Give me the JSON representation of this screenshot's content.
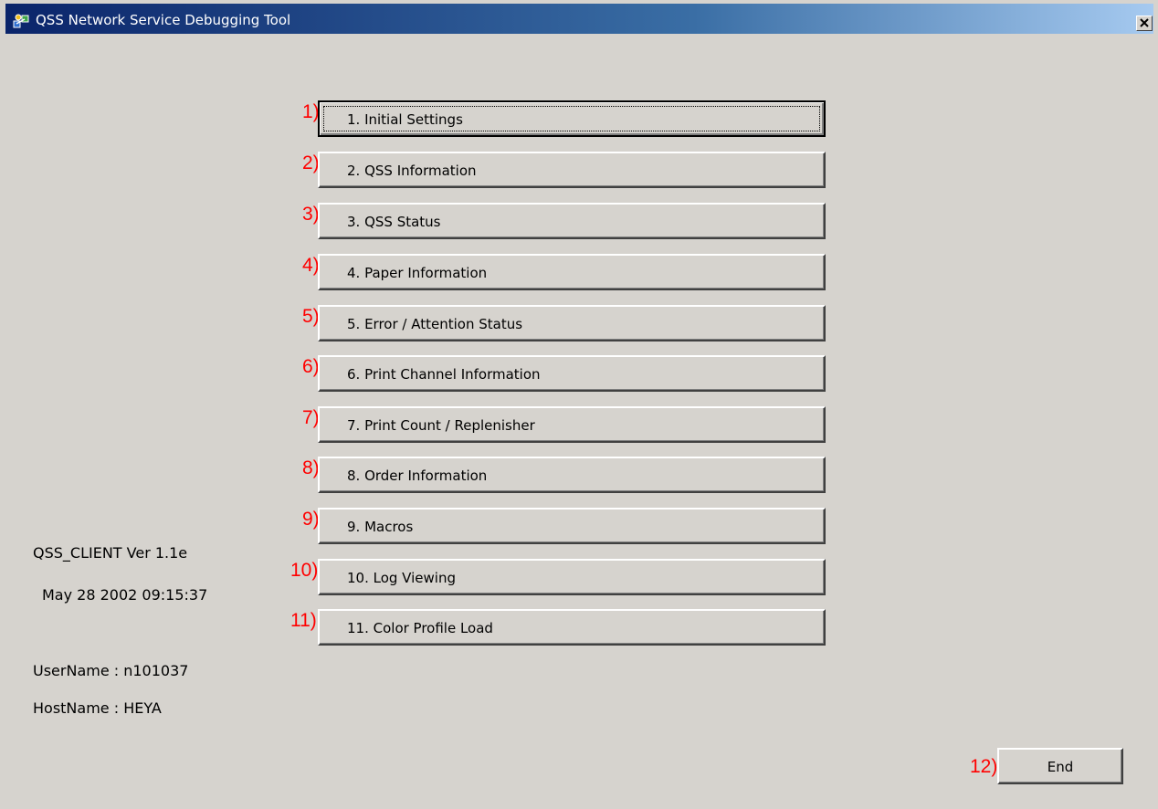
{
  "window": {
    "title": "QSS Network Service Debugging Tool",
    "close_icon": "close-icon",
    "titlebar_colors": [
      "#0a246a",
      "#a6caf0"
    ]
  },
  "menu": {
    "buttons": [
      {
        "marker": "1)",
        "label": "1.  Initial Settings"
      },
      {
        "marker": "2)",
        "label": "2.  QSS Information"
      },
      {
        "marker": "3)",
        "label": "3.  QSS Status"
      },
      {
        "marker": "4)",
        "label": "4.  Paper Information"
      },
      {
        "marker": "5)",
        "label": "5.  Error / Attention Status"
      },
      {
        "marker": "6)",
        "label": "6.  Print Channel Information"
      },
      {
        "marker": "7)",
        "label": "7.  Print Count / Replenisher"
      },
      {
        "marker": "8)",
        "label": "8.  Order Information"
      },
      {
        "marker": "9)",
        "label": "9.  Macros"
      },
      {
        "marker": "10)",
        "label": "10. Log Viewing"
      },
      {
        "marker": "11)",
        "label": "11. Color Profile Load"
      }
    ]
  },
  "info": {
    "version": "QSS_CLIENT Ver 1.1e",
    "build_date": "May 28 2002 09:15:37",
    "username": "UserName : n101037",
    "hostname": "HostName : HEYA"
  },
  "footer": {
    "end_marker": "12)",
    "end_label": "End"
  },
  "colors": {
    "face": "#d6d3ce",
    "marker": "#ff0000"
  }
}
